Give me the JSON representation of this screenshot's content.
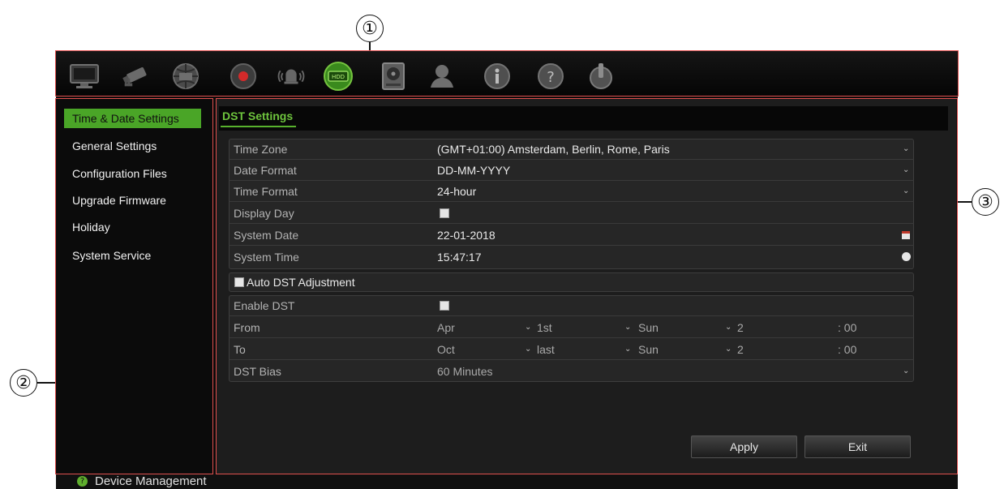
{
  "callouts": {
    "c1": "①",
    "c2": "②",
    "c3": "③"
  },
  "toolbar": {
    "items": [
      {
        "icon": "monitor-icon"
      },
      {
        "icon": "camera-icon"
      },
      {
        "icon": "network-icon"
      },
      {
        "icon": "record-icon"
      },
      {
        "icon": "alarm-icon"
      },
      {
        "icon": "device-management-icon",
        "active": true
      },
      {
        "icon": "storage-icon"
      },
      {
        "icon": "user-icon"
      },
      {
        "icon": "information-icon"
      },
      {
        "icon": "help-icon"
      },
      {
        "icon": "power-icon"
      }
    ]
  },
  "sidebar": {
    "items": [
      {
        "label": "Time & Date Settings",
        "active": true
      },
      {
        "label": "General Settings"
      },
      {
        "label": "Configuration Files"
      },
      {
        "label": "Upgrade Firmware"
      },
      {
        "label": "Holiday"
      },
      {
        "label": "System Service"
      }
    ]
  },
  "tab": {
    "label": "DST Settings"
  },
  "settings": {
    "time_zone": {
      "label": "Time Zone",
      "value": "(GMT+01:00) Amsterdam, Berlin, Rome, Paris"
    },
    "date_format": {
      "label": "Date Format",
      "value": "DD-MM-YYYY"
    },
    "time_format": {
      "label": "Time Format",
      "value": "24-hour"
    },
    "display_day": {
      "label": "Display Day",
      "checked": false
    },
    "system_date": {
      "label": "System Date",
      "value": "22-01-2018"
    },
    "system_time": {
      "label": "System Time",
      "value": "15:47:17"
    }
  },
  "auto_dst": {
    "label": "Auto DST Adjustment",
    "checked": false
  },
  "dst": {
    "enable": {
      "label": "Enable DST",
      "checked": false
    },
    "from": {
      "label": "From",
      "month": "Apr",
      "week": "1st",
      "day": "Sun",
      "hour": "2",
      "minute": ": 00"
    },
    "to": {
      "label": "To",
      "month": "Oct",
      "week": "last",
      "day": "Sun",
      "hour": "2",
      "minute": ": 00"
    },
    "bias": {
      "label": "DST Bias",
      "value": "60 Minutes"
    }
  },
  "buttons": {
    "apply": "Apply",
    "exit": "Exit"
  },
  "statusbar": {
    "label": "Device Management",
    "icon": "help-icon",
    "icon_color": "#5fae2e"
  },
  "colors": {
    "accent": "#4aa527",
    "frame": "#e0504f",
    "background": "#0b0b0b"
  }
}
